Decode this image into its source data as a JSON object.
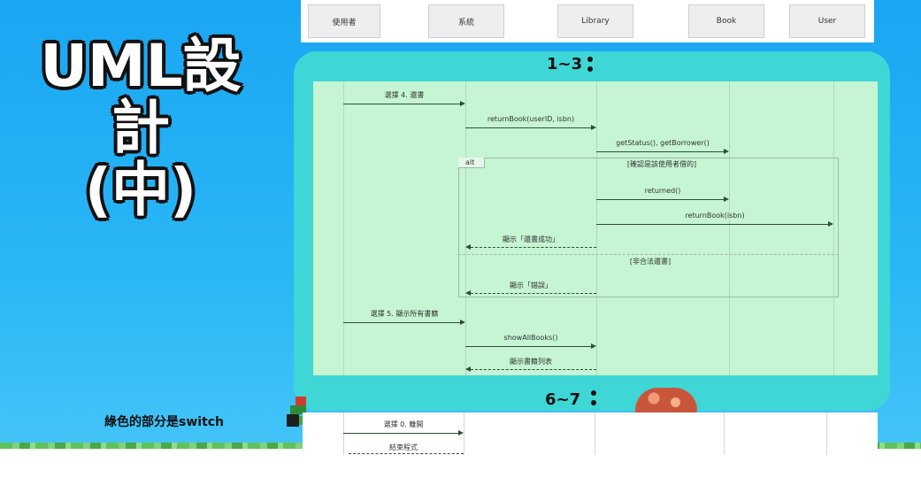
{
  "slide": {
    "title_line1": "UML設計",
    "title_line2": "(中)",
    "note": "綠色的部分是switch",
    "section_top": "1~3",
    "section_bottom": "6~7"
  },
  "actors": [
    "使用者",
    "系統",
    "Library",
    "Book",
    "User"
  ],
  "alt": {
    "tag": "alt",
    "guard1": "[確認是該使用者借的]",
    "guard2": "[非合法還書]"
  },
  "messages": {
    "m1": "選擇 4. 還書",
    "m2": "returnBook(userID, isbn)",
    "m3": "getStatus(), getBorrower()",
    "m4": "returned()",
    "m5": "returnBook(isbn)",
    "m6": "顯示「還書成功」",
    "m7": "顯示「錯誤」",
    "m8": "選擇 5. 顯示所有書籍",
    "m9": "showAllBooks()",
    "m10": "顯示書籍列表",
    "m11": "選擇 0. 離開",
    "m12": "結束程式"
  },
  "colors": {
    "background": "#1aa6f2",
    "panel": "#3fd6d6",
    "diagram_fill": "#c5f5d2"
  }
}
